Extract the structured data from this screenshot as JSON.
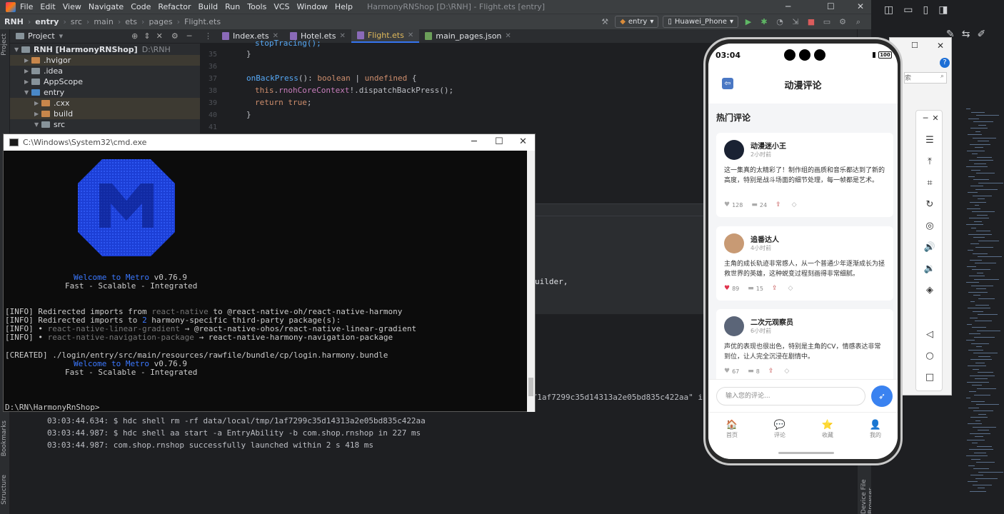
{
  "ide": {
    "menus": [
      "File",
      "Edit",
      "View",
      "Navigate",
      "Code",
      "Refactor",
      "Build",
      "Run",
      "Tools",
      "VCS",
      "Window",
      "Help"
    ],
    "window_title": "HarmonyRNShop [D:\\RNH] - Flight.ets [entry]",
    "breadcrumb": [
      "RNH",
      "entry",
      "src",
      "main",
      "ets",
      "pages",
      "Flight.ets"
    ],
    "module_select": "entry",
    "device_select": "Huawei_Phone",
    "project_panel_label": "Project",
    "tree": [
      {
        "label": "RNH [HarmonyRNShop]",
        "suffix": "D:\\RNH",
        "indent": 0,
        "color": "grey",
        "expanded": true
      },
      {
        "label": ".hvigor",
        "indent": 1,
        "color": "orange",
        "expanded": false,
        "hl": true
      },
      {
        "label": ".idea",
        "indent": 1,
        "color": "grey",
        "expanded": false
      },
      {
        "label": "AppScope",
        "indent": 1,
        "color": "grey",
        "expanded": false
      },
      {
        "label": "entry",
        "indent": 1,
        "color": "blue",
        "expanded": true
      },
      {
        "label": ".cxx",
        "indent": 2,
        "color": "orange",
        "expanded": false,
        "hl": true
      },
      {
        "label": "build",
        "indent": 2,
        "color": "orange",
        "expanded": false,
        "hl": true
      },
      {
        "label": "src",
        "indent": 2,
        "color": "grey",
        "expanded": true
      }
    ],
    "tabs": [
      {
        "label": "Index.ets",
        "active": false
      },
      {
        "label": "Hotel.ets",
        "active": false
      },
      {
        "label": "Flight.ets",
        "active": true
      },
      {
        "label": "main_pages.json",
        "active": false
      }
    ],
    "line_numbers": [
      "35",
      "36",
      "37",
      "38",
      "39",
      "40",
      "41"
    ],
    "code_top_partial": "stopTracing();",
    "code_lines": {
      "l35": "}",
      "l37_fn": "onBackPress",
      "l37_rest1": "(): ",
      "l37_type1": "boolean",
      "l37_pipe": " | ",
      "l37_type2": "undefined",
      "l37_brace": " {",
      "l38_this": "this",
      "l38_dot": ".",
      "l38_field": "rnohCoreContext",
      "l38_rest": "!.dispatchBackPress();",
      "l39_return": "return",
      "l39_true": " true",
      "l39_semi": ";",
      "l40": "}"
    },
    "builder_text": "uilder,",
    "hash_line": "p/1af7299c35d14313a2e05bd835c422aa\" in",
    "run_lines": [
      "03:03:44.634: $ hdc shell rm -rf data/local/tmp/1af7299c35d14313a2e05bd835c422aa",
      "03:03:44.987: $ hdc shell aa start -a EntryAbility -b com.shop.rnshop in 227 ms",
      "03:03:44.987: com.shop.rnshop successfully launched within 2 s 418 ms"
    ],
    "left_tools": [
      "Project",
      "Bookmarks",
      "Structure"
    ],
    "right_tools": [
      "Device File Browser"
    ]
  },
  "cmd": {
    "title": "C:\\Windows\\System32\\cmd.exe",
    "welcome_1_prefix": "Welcome to Metro",
    "welcome_1_version": " v0.76.9",
    "tagline_1": "Fast - Scalable - Integrated",
    "info_1_prefix": "[INFO] Redirected imports from ",
    "info_1_dim": "react-native",
    "info_1_rest": " to @react-native-oh/react-native-harmony",
    "info_2_prefix": "[INFO] Redirected imports to ",
    "info_2_blue": "2",
    "info_2_rest": " harmony-specific third-party package(s):",
    "info_3_prefix": "[INFO] • ",
    "info_3_dim": "react-native-linear-gradient",
    "info_3_rest": " → @react-native-ohos/react-native-linear-gradient",
    "info_4_prefix": "[INFO] • ",
    "info_4_dim": "react-native-navigation-package",
    "info_4_rest": " → react-native-harmony-navigation-package",
    "created": "[CREATED] ./login/entry/src/main/resources/rawfile/bundle/cp/login.harmony.bundle",
    "welcome_2_prefix": "Welcome to Metro",
    "welcome_2_version": " v0.76.9",
    "tagline_2": "Fast - Scalable - Integrated",
    "prompt": "D:\\RN\\HarmonyRnShop>"
  },
  "phone": {
    "time": "03:04",
    "battery": "100",
    "header_title": "动漫评论",
    "section_title": "热门评论",
    "comments": [
      {
        "user": "动漫迷小王",
        "time": "2小时前",
        "text": "这一集真的太精彩了！制作组的画质和音乐都达到了新的高度，特别是战斗场面的细节处理，每一帧都是艺术。",
        "likes": "128",
        "replies": "24",
        "liked": false,
        "avatar_color": "#1a2233"
      },
      {
        "user": "追番达人",
        "time": "4小时前",
        "text": "主角的成长轨迹非常感人，从一个普通少年逐渐成长为拯救世界的英雄，这种蜕变过程刻画得非常细腻。",
        "likes": "89",
        "replies": "15",
        "liked": true,
        "avatar_color": "#c89a74"
      },
      {
        "user": "二次元观察员",
        "time": "6小时前",
        "text": "声优的表现也很出色，特别是主角的CV，情感表达非常到位，让人完全沉浸在剧情中。",
        "likes": "67",
        "replies": "8",
        "liked": false,
        "avatar_color": "#5b6578"
      }
    ],
    "input_placeholder": "输入您的评论...",
    "tabs": [
      {
        "label": "首页",
        "icon": "home-icon",
        "glyph": "🏠"
      },
      {
        "label": "评论",
        "icon": "comment-icon",
        "glyph": "💬"
      },
      {
        "label": "收藏",
        "icon": "star-icon",
        "glyph": "⭐"
      },
      {
        "label": "我的",
        "icon": "profile-icon",
        "glyph": "👤"
      }
    ]
  },
  "win2": {
    "search_placeholder": "索"
  },
  "colors": {
    "accent": "#3a82f0",
    "metro_blue": "#3b78ff",
    "liked": "#e0334d",
    "ide_bg": "#2b2d30"
  }
}
